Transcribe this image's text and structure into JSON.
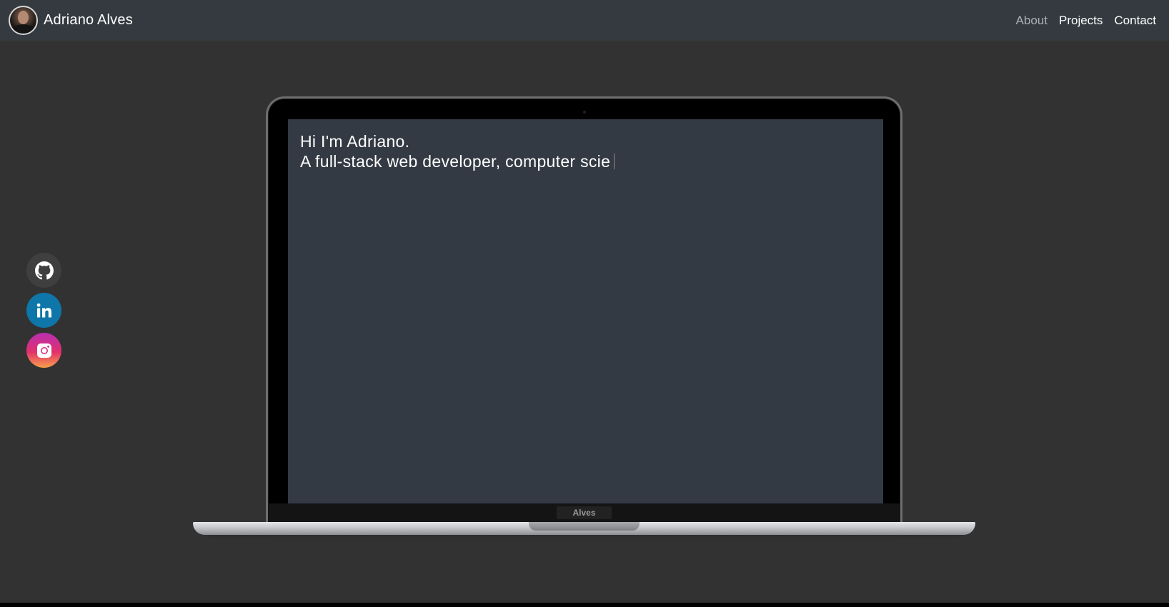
{
  "navbar": {
    "brand_name": "Adriano Alves",
    "links": [
      {
        "label": "About",
        "active": true
      },
      {
        "label": "Projects",
        "active": false
      },
      {
        "label": "Contact",
        "active": false
      }
    ]
  },
  "social": [
    {
      "name": "GitHub",
      "icon": "github-icon",
      "color": "#3f3f3f"
    },
    {
      "name": "LinkedIn",
      "icon": "linkedin-icon",
      "color": "#0e76a8"
    },
    {
      "name": "Instagram",
      "icon": "instagram-icon",
      "color": "#e2306c"
    }
  ],
  "laptop": {
    "screen_lines": [
      "Hi I'm Adriano.",
      "A full-stack web developer, computer scie"
    ],
    "label": "Alves"
  },
  "colors": {
    "background": "#323232",
    "navbar": "#343a40",
    "screen": "#343a44"
  }
}
